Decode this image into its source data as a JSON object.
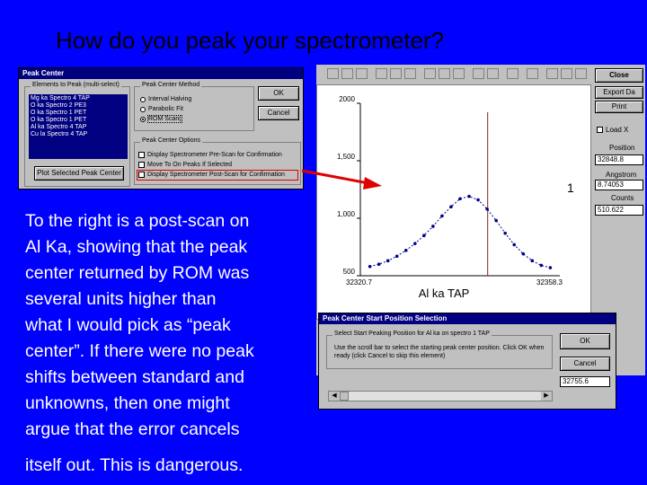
{
  "slide": {
    "title": "How do you peak your spectrometer?",
    "body_lines": [
      "To the right is a post-scan on",
      "Al Ka,  showing that the peak",
      "center returned by ROM was",
      "several units higher than",
      "what I would pick as “peak",
      "center”. If there were no peak",
      "shifts between standard and",
      "unknowns, then one might",
      "argue that the error cancels",
      "itself out. This is dangerous."
    ]
  },
  "peak_center_dialog": {
    "title": "Peak Center",
    "elements_group_label": "Elements to Peak (multi-select)",
    "elements": [
      "Mg ka Spectro  4 TAP",
      "O ka Spectro  2 PE3",
      "O ka Spectro  1 PET",
      "O ka Spectro  1 PET",
      "Al ka Spectro  4 TAP",
      "Cu la Spectro  4 TAP"
    ],
    "plot_button": "Plot Selected Peak Center",
    "method_group_label": "Peak Center Method",
    "methods": [
      "Interval Halving",
      "Parabolic Fit",
      "ROM Scan("
    ],
    "selected_method_index": 2,
    "ok_label": "OK",
    "cancel_label": "Cancel",
    "options_group_label": "Peak Center Options",
    "options": [
      "Display Spectrometer Pre-Scan for Confirmation",
      "Move To On Peaks If Selected",
      "Display Spectrometer Post-Scan for Confirmation"
    ]
  },
  "scan_window": {
    "close_label": "Close",
    "export_label": "Export Da",
    "print_label": "Print",
    "load_label": "Load X",
    "position_label": "Position",
    "position_value": "32848.8",
    "angstrom_label": "Angstrom",
    "angstrom_value": "8.74053",
    "counts_label": "Counts",
    "counts_value": "510.622",
    "annotation_number": "1",
    "colors": {
      "curve": "#00008b",
      "marker": "#8b1a1a",
      "arrow": "#e00000"
    }
  },
  "chart_data": {
    "type": "scatter",
    "title": "",
    "series_label": "Al ka TAP",
    "xlabel": "",
    "ylabel": "",
    "x_tick_labels": [
      "32320.7",
      "32358.3"
    ],
    "y_tick_labels": [
      "500",
      "1,000",
      "1,500",
      "2000"
    ],
    "xlim": [
      32320.7,
      32358.3
    ],
    "ylim": [
      500,
      2000
    ],
    "peak_marker_x": 32344.7,
    "grid": false,
    "x": [
      32322.5,
      32324.2,
      32325.9,
      32327.6,
      32329.3,
      32331.0,
      32332.7,
      32334.4,
      32336.1,
      32337.8,
      32339.5,
      32341.2,
      32342.9,
      32344.6,
      32346.3,
      32348.0,
      32349.7,
      32351.4,
      32353.1,
      32354.8,
      32356.5
    ],
    "y": [
      580,
      600,
      630,
      670,
      720,
      780,
      850,
      930,
      1020,
      1100,
      1170,
      1190,
      1160,
      1080,
      980,
      870,
      770,
      690,
      630,
      590,
      570
    ]
  },
  "start_position_dialog": {
    "title": "Peak Center Start Position Selection",
    "group_label": "Select Start Peaking Position for Al ka on spectro  1 TAP",
    "instructions": "Use the scroll bar to select the starting peak center position. Click OK when ready (click Cancel to skip this element)",
    "ok_label": "OK",
    "cancel_label": "Cancel",
    "position_value": "32755.6"
  }
}
